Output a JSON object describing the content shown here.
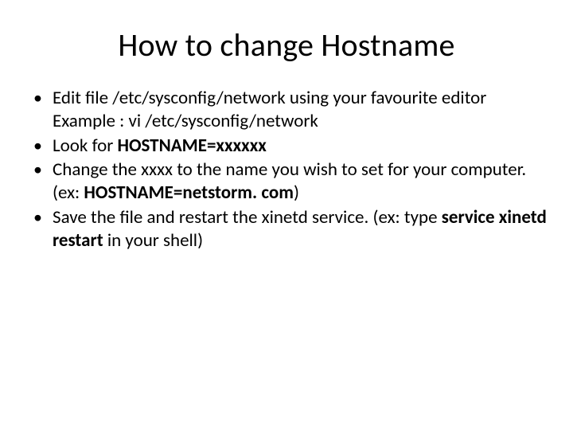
{
  "slide": {
    "title": "How to change Hostname",
    "bullets": {
      "b1": {
        "line1": "Edit file /etc/sysconfig/network using your favourite editor",
        "line2": "Example : vi /etc/sysconfig/network"
      },
      "b2": {
        "prefix": "Look for ",
        "bold": "HOSTNAME=xxxxxx"
      },
      "b3": {
        "part1": "Change the xxxx to the name you wish to set for your computer. (ex: ",
        "bold": "HOSTNAME=netstorm. com",
        "part2": ")"
      },
      "b4": {
        "part1": "Save the file and restart the xinetd service. (ex: type ",
        "bold": "service xinetd restart",
        "part2": " in your shell)"
      }
    }
  }
}
